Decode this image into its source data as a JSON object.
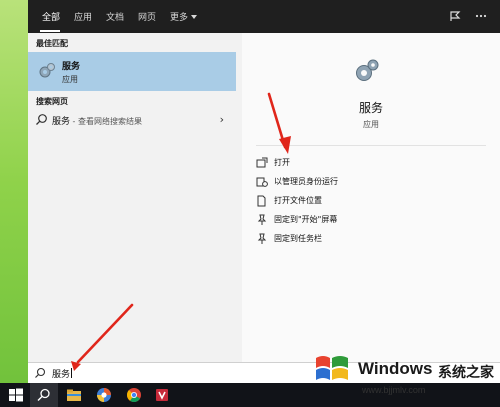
{
  "tabs": [
    {
      "label": "全部",
      "active": true
    },
    {
      "label": "应用",
      "active": false
    },
    {
      "label": "文档",
      "active": false
    },
    {
      "label": "网页",
      "active": false
    },
    {
      "label": "更多",
      "active": false
    }
  ],
  "left": {
    "best_match_header": "最佳匹配",
    "best_match": {
      "name": "服务",
      "type": "应用",
      "icon": "gear-icon"
    },
    "web_header": "搜索网页",
    "web_result": {
      "query": "服务",
      "hint": " - 查看网络搜索结果"
    }
  },
  "right": {
    "title": "服务",
    "type": "应用",
    "actions": [
      {
        "label": "打开",
        "icon": "open-icon"
      },
      {
        "label": "以管理员身份运行",
        "icon": "shield-icon"
      },
      {
        "label": "打开文件位置",
        "icon": "file-location-icon"
      },
      {
        "label": "固定到\"开始\"屏幕",
        "icon": "pin-icon"
      },
      {
        "label": "固定到任务栏",
        "icon": "pin-icon"
      }
    ]
  },
  "search": {
    "value": "服务"
  },
  "watermark": {
    "brand": "Windows",
    "brand_cn": "系统之家",
    "url": "www.bjjmlv.com"
  },
  "colors": {
    "accent": "#a9cce6",
    "topbar": "#1f1f1f",
    "arrow": "#e0261b",
    "taskbar": "#111318"
  }
}
